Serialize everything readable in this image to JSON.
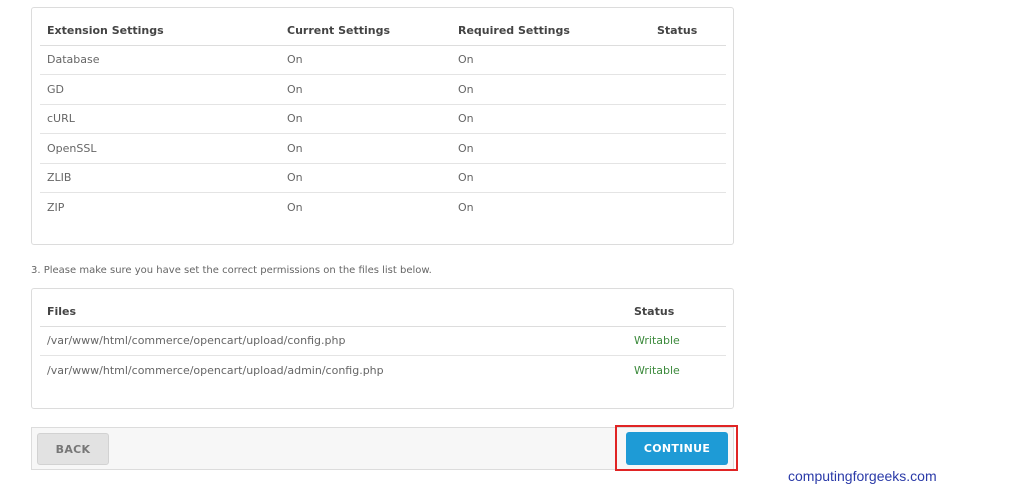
{
  "extensions": {
    "headers": [
      "Extension Settings",
      "Current Settings",
      "Required Settings",
      "Status"
    ],
    "rows": [
      {
        "name": "Database",
        "current": "On",
        "required": "On",
        "status": ""
      },
      {
        "name": "GD",
        "current": "On",
        "required": "On",
        "status": ""
      },
      {
        "name": "cURL",
        "current": "On",
        "required": "On",
        "status": ""
      },
      {
        "name": "OpenSSL",
        "current": "On",
        "required": "On",
        "status": ""
      },
      {
        "name": "ZLIB",
        "current": "On",
        "required": "On",
        "status": ""
      },
      {
        "name": "ZIP",
        "current": "On",
        "required": "On",
        "status": ""
      }
    ]
  },
  "permissions_note": "3. Please make sure you have set the correct permissions on the files list below.",
  "files": {
    "headers": [
      "Files",
      "Status"
    ],
    "rows": [
      {
        "path": "/var/www/html/commerce/opencart/upload/config.php",
        "status": "Writable"
      },
      {
        "path": "/var/www/html/commerce/opencart/upload/admin/config.php",
        "status": "Writable"
      }
    ]
  },
  "actions": {
    "back_label": "BACK",
    "continue_label": "CONTINUE"
  },
  "watermark": "computingforgeeks.com",
  "colors": {
    "accent": "#1e9bd6",
    "writable": "#3c8a3c",
    "highlight": "#e02424"
  }
}
